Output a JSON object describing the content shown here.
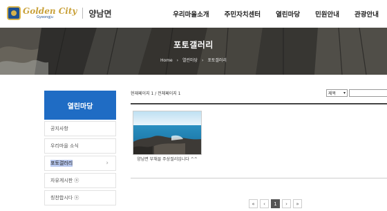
{
  "header": {
    "logo_main": "Golden City",
    "logo_sub": "Gyeongju",
    "town": "양남면",
    "nav": [
      "우리마을소개",
      "주민자치센터",
      "열린마당",
      "민원안내",
      "관광안내"
    ]
  },
  "banner": {
    "title": "포토갤러리",
    "breadcrumb": [
      "Home",
      "열린마당",
      "포토갤러리"
    ]
  },
  "sidebar": {
    "title": "열린마당",
    "items": [
      {
        "label": "공지사항"
      },
      {
        "label": "우리마을 소식"
      },
      {
        "label": "포토갤러리"
      },
      {
        "label": "자유게시판 ⓝ"
      },
      {
        "label": "칭찬합시다 ⓝ"
      }
    ]
  },
  "content": {
    "page_info": "현재페이지 1 / 전체페이지 1",
    "search_select": "제목",
    "gallery": [
      {
        "caption": "양남면 부채꼴 주상절리입니다 ^^"
      }
    ]
  },
  "pagination": {
    "first": "«",
    "prev": "‹",
    "current": "1",
    "next": "›",
    "last": "»"
  },
  "colors": {
    "accent": "#1f6cc4",
    "active_highlight": "#b7c7ee"
  }
}
